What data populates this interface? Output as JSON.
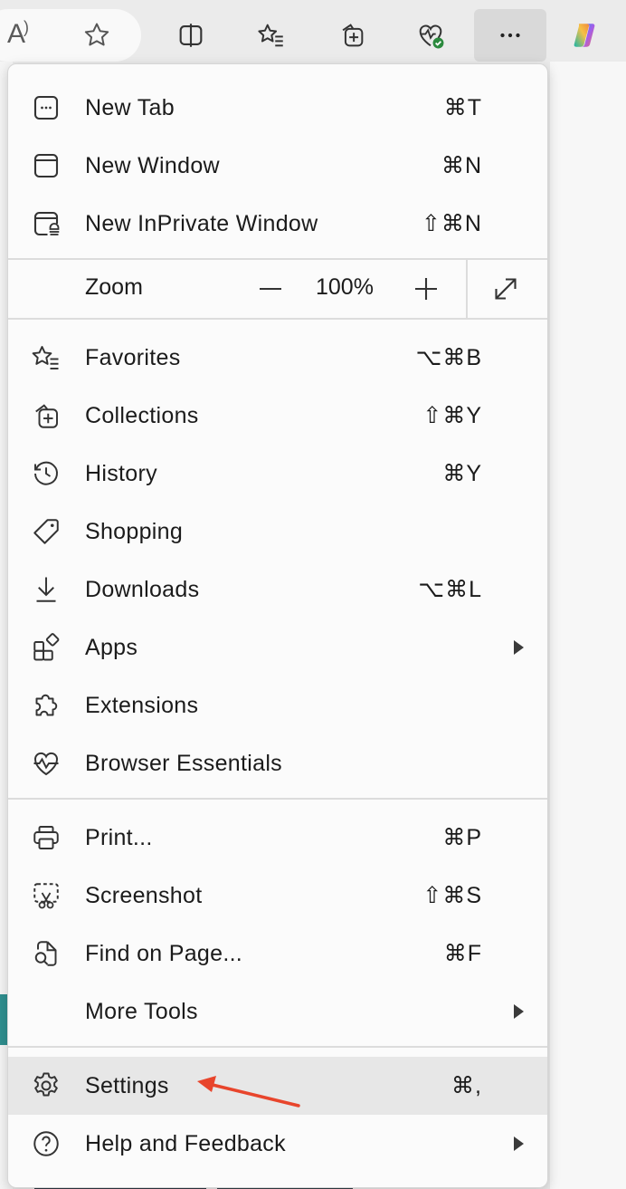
{
  "toolbar": {
    "buttons": [
      "read-aloud",
      "favorite-star",
      "split-screen",
      "favorites",
      "collections",
      "browser-essentials",
      "settings-and-more",
      "copilot"
    ],
    "accent_green": "#2b8a3e"
  },
  "menu": {
    "items_top": [
      {
        "label": "New Tab",
        "shortcut": "⌘T",
        "icon": "new-tab-icon"
      },
      {
        "label": "New Window",
        "shortcut": "⌘N",
        "icon": "new-window-icon"
      },
      {
        "label": "New InPrivate Window",
        "shortcut": "⇧⌘N",
        "icon": "inprivate-window-icon"
      }
    ],
    "zoom": {
      "label": "Zoom",
      "value": "100%"
    },
    "items_middle": [
      {
        "label": "Favorites",
        "shortcut": "⌥⌘B",
        "icon": "favorites-icon"
      },
      {
        "label": "Collections",
        "shortcut": "⇧⌘Y",
        "icon": "collections-icon"
      },
      {
        "label": "History",
        "shortcut": "⌘Y",
        "icon": "history-icon"
      },
      {
        "label": "Shopping",
        "shortcut": "",
        "icon": "tag-icon"
      },
      {
        "label": "Downloads",
        "shortcut": "⌥⌘L",
        "icon": "download-icon"
      },
      {
        "label": "Apps",
        "shortcut": "",
        "icon": "apps-icon",
        "submenu": true
      },
      {
        "label": "Extensions",
        "shortcut": "",
        "icon": "puzzle-icon"
      },
      {
        "label": "Browser Essentials",
        "shortcut": "",
        "icon": "heartbeat-icon"
      }
    ],
    "items_tools": [
      {
        "label": "Print...",
        "shortcut": "⌘P",
        "icon": "printer-icon"
      },
      {
        "label": "Screenshot",
        "shortcut": "⇧⌘S",
        "icon": "screenshot-icon"
      },
      {
        "label": "Find on Page...",
        "shortcut": "⌘F",
        "icon": "find-icon"
      },
      {
        "label": "More Tools",
        "shortcut": "",
        "icon": "",
        "submenu": true
      }
    ],
    "items_bottom": [
      {
        "label": "Settings",
        "shortcut": "⌘,",
        "icon": "gear-icon",
        "highlighted": true
      },
      {
        "label": "Help and Feedback",
        "shortcut": "",
        "icon": "help-icon",
        "submenu": true
      }
    ]
  },
  "colors": {
    "annotation_arrow": "#e8452c",
    "highlight": "#e7e7e7"
  }
}
